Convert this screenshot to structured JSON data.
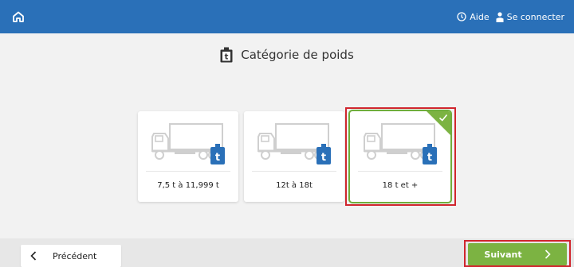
{
  "header": {
    "home_icon": "home-icon",
    "help_label": "Aide",
    "login_label": "Se connecter"
  },
  "page": {
    "title": "Catégorie de poids",
    "title_icon": "weight-t-icon"
  },
  "categories": [
    {
      "label": "7,5 t à 11,999 t",
      "selected": false,
      "badge": "t"
    },
    {
      "label": "12t à 18t",
      "selected": false,
      "badge": "t"
    },
    {
      "label": "18 t et +",
      "selected": true,
      "badge": "t"
    }
  ],
  "footer": {
    "prev_label": "Précédent",
    "next_label": "Suivant"
  },
  "colors": {
    "brand_blue": "#2a70b8",
    "accent_green": "#7cb342",
    "highlight_red": "#d0262e"
  }
}
